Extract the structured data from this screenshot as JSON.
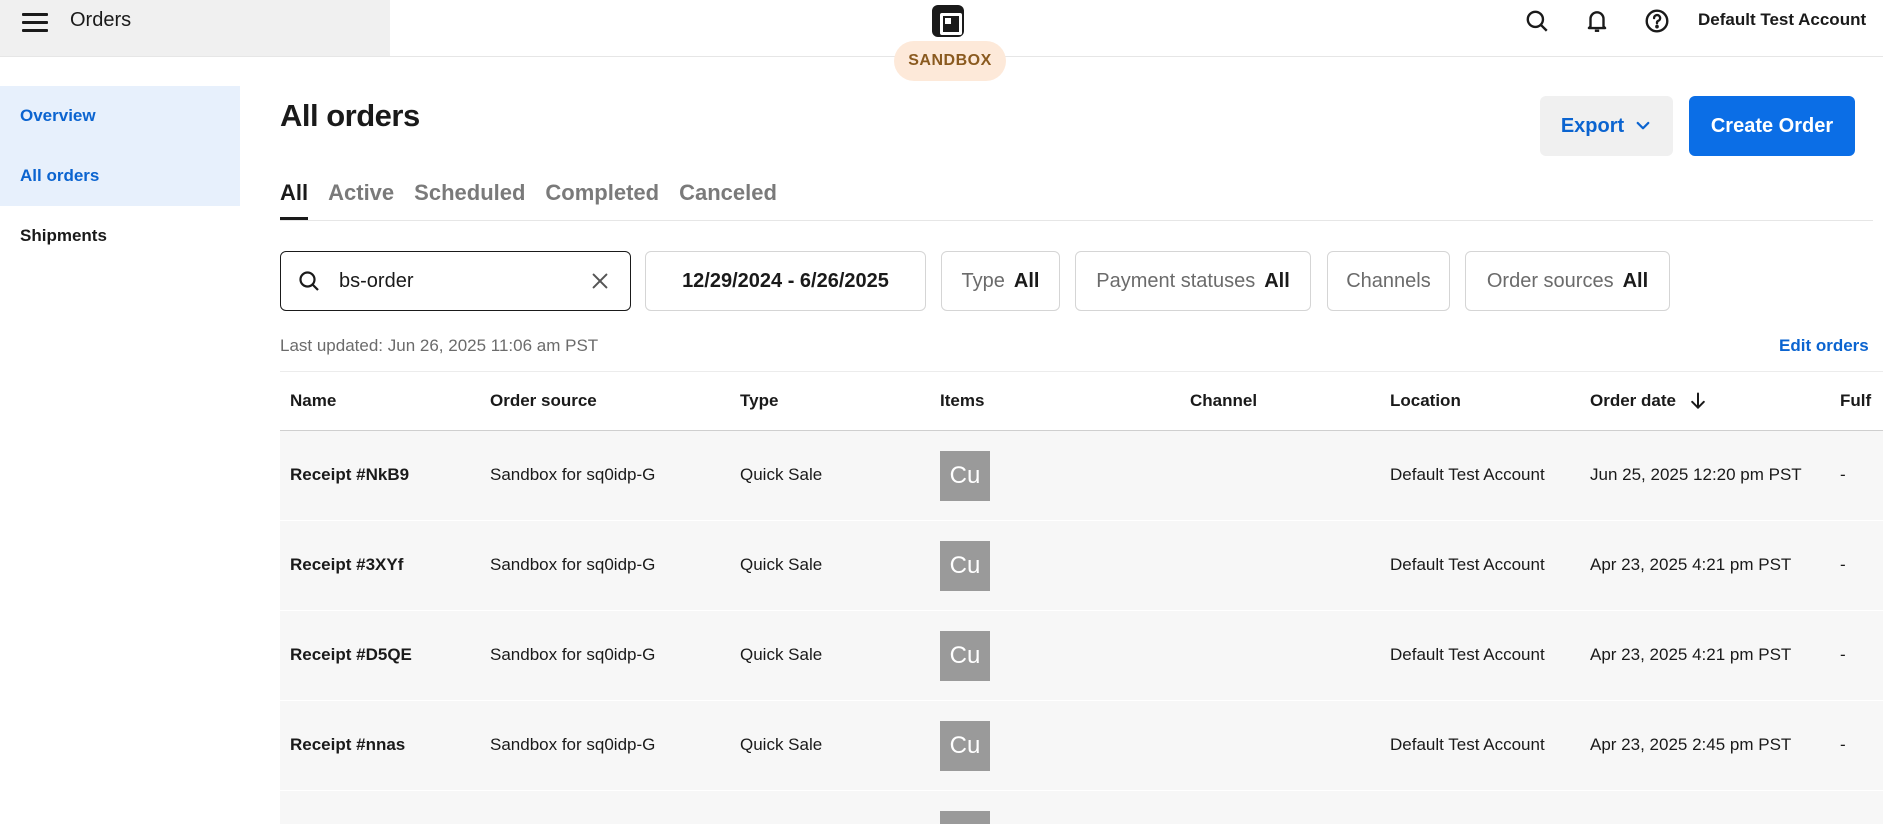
{
  "app": {
    "title": "Orders",
    "badge": "SANDBOX",
    "account": "Default Test Account"
  },
  "sidebar": {
    "items": [
      {
        "label": "Overview"
      },
      {
        "label": "All orders"
      },
      {
        "label": "Shipments"
      }
    ]
  },
  "page": {
    "title": "All orders",
    "export_label": "Export",
    "create_label": "Create Order"
  },
  "tabs": [
    {
      "label": "All"
    },
    {
      "label": "Active"
    },
    {
      "label": "Scheduled"
    },
    {
      "label": "Completed"
    },
    {
      "label": "Canceled"
    }
  ],
  "filters": {
    "search_value": "bs-order",
    "date_range": "12/29/2024 - 6/26/2025",
    "type": {
      "label": "Type",
      "value": "All"
    },
    "payment": {
      "label": "Payment statuses",
      "value": "All"
    },
    "channels": {
      "label": "Channels"
    },
    "sources": {
      "label": "Order sources",
      "value": "All"
    }
  },
  "meta": {
    "last_updated": "Last updated: Jun 26, 2025 11:06 am PST",
    "edit_orders": "Edit orders"
  },
  "table": {
    "headers": [
      "Name",
      "Order source",
      "Type",
      "Items",
      "Channel",
      "Location",
      "Order date",
      "Fulf"
    ],
    "rows": [
      {
        "name": "Receipt #NkB9",
        "source": "Sandbox for sq0idp-G",
        "type": "Quick Sale",
        "item": "Cu",
        "channel": "",
        "location": "Default Test Account",
        "date": "Jun 25, 2025 12:20 pm PST",
        "fulfillment": "-"
      },
      {
        "name": "Receipt #3XYf",
        "source": "Sandbox for sq0idp-G",
        "type": "Quick Sale",
        "item": "Cu",
        "channel": "",
        "location": "Default Test Account",
        "date": "Apr 23, 2025 4:21 pm PST",
        "fulfillment": "-"
      },
      {
        "name": "Receipt #D5QE",
        "source": "Sandbox for sq0idp-G",
        "type": "Quick Sale",
        "item": "Cu",
        "channel": "",
        "location": "Default Test Account",
        "date": "Apr 23, 2025 4:21 pm PST",
        "fulfillment": "-"
      },
      {
        "name": "Receipt #nnas",
        "source": "Sandbox for sq0idp-G",
        "type": "Quick Sale",
        "item": "Cu",
        "channel": "",
        "location": "Default Test Account",
        "date": "Apr 23, 2025 2:45 pm PST",
        "fulfillment": "-"
      }
    ]
  },
  "icons": {
    "menu": "hamburger-menu-icon",
    "logo": "square-logo-icon",
    "search": "search-icon",
    "notifications": "bell-icon",
    "help": "help-icon",
    "export_chevron": "chevron-down-icon",
    "clear": "close-icon",
    "sort": "arrow-down-icon"
  },
  "colors": {
    "accent": "#0b64d0",
    "primary_button": "#0b6ee6",
    "badge_bg": "#fde9d9",
    "badge_text": "#8a5a1f",
    "sidebar_active_bg": "#e7f0fc"
  }
}
